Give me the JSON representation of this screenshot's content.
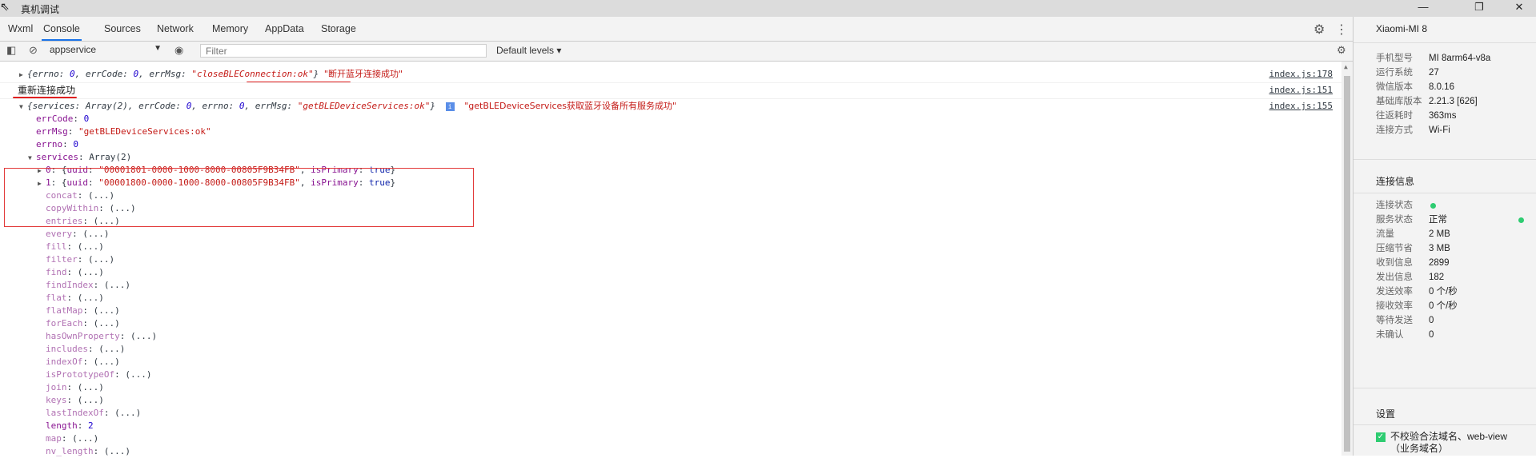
{
  "window": {
    "title": "真机调试",
    "buttons": {
      "minimize": "—",
      "restore": "❐",
      "close": "✕"
    }
  },
  "tabs": [
    {
      "label": "Wxml"
    },
    {
      "label": "Console"
    },
    {
      "label": "Sources"
    },
    {
      "label": "Network"
    },
    {
      "label": "Memory"
    },
    {
      "label": "AppData"
    },
    {
      "label": "Storage"
    }
  ],
  "toolbar": {
    "context": "appservice",
    "filter_placeholder": "Filter",
    "levels": "Default levels"
  },
  "console": {
    "line1": {
      "prefix": "{errno: ",
      "errno": "0",
      "mid1": ", errCode: ",
      "errCode": "0",
      "mid2": ", errMsg: ",
      "errMsg": "\"closeBLEConnection:ok\"",
      "suffix": "}",
      "message": "\"断开蓝牙连接成功\"",
      "source": "index.js:178"
    },
    "line2": {
      "message": "重新连接成功",
      "source": "index.js:151"
    },
    "line3": {
      "p1": "{services: Array(2), errCode: ",
      "errCode": "0",
      "p2": ", errno: ",
      "errno": "0",
      "p3": ", errMsg: ",
      "errMsg": "\"getBLEDeviceServices:ok\"",
      "p4": "}",
      "info": "i",
      "message": "\"getBLEDeviceServices获取蓝牙设备所有服务成功\"",
      "source": "index.js:155"
    },
    "props": {
      "errCode_key": "errCode",
      "errCode_val": "0",
      "errMsg_key": "errMsg",
      "errMsg_val": "\"getBLEDeviceServices:ok\"",
      "errno_key": "errno",
      "errno_val": "0",
      "services_key": "services",
      "services_val": "Array(2)"
    },
    "services": [
      {
        "idx": "0",
        "uuid": "\"00001801-0000-1000-8000-00805F9B34FB\"",
        "isPrimary": "true"
      },
      {
        "idx": "1",
        "uuid": "\"00001800-0000-1000-8000-00805F9B34FB\"",
        "isPrimary": "true"
      }
    ],
    "array_methods": [
      {
        "name": "concat",
        "val": "(...)"
      },
      {
        "name": "copyWithin",
        "val": "(...)"
      },
      {
        "name": "entries",
        "val": "(...)"
      },
      {
        "name": "every",
        "val": "(...)"
      },
      {
        "name": "fill",
        "val": "(...)"
      },
      {
        "name": "filter",
        "val": "(...)"
      },
      {
        "name": "find",
        "val": "(...)"
      },
      {
        "name": "findIndex",
        "val": "(...)"
      },
      {
        "name": "flat",
        "val": "(...)"
      },
      {
        "name": "flatMap",
        "val": "(...)"
      },
      {
        "name": "forEach",
        "val": "(...)"
      },
      {
        "name": "hasOwnProperty",
        "val": "(...)"
      },
      {
        "name": "includes",
        "val": "(...)"
      },
      {
        "name": "indexOf",
        "val": "(...)"
      },
      {
        "name": "isPrototypeOf",
        "val": "(...)"
      },
      {
        "name": "join",
        "val": "(...)"
      },
      {
        "name": "keys",
        "val": "(...)"
      },
      {
        "name": "lastIndexOf",
        "val": "(...)"
      },
      {
        "name": "length",
        "val": "2"
      },
      {
        "name": "map",
        "val": "(...)"
      },
      {
        "name": "nv_length",
        "val": "(...)"
      }
    ]
  },
  "device": {
    "name": "Xiaomi-MI 8",
    "info": [
      {
        "k": "手机型号",
        "v": "MI 8arm64-v8a"
      },
      {
        "k": "运行系统",
        "v": "27"
      },
      {
        "k": "微信版本",
        "v": "8.0.16"
      },
      {
        "k": "基础库版本",
        "v": "2.21.3 [626]"
      },
      {
        "k": "往返耗时",
        "v": "363ms"
      },
      {
        "k": "连接方式",
        "v": "Wi-Fi"
      }
    ],
    "conn_title": "连接信息",
    "conn": [
      {
        "k": "连接状态",
        "v": ""
      },
      {
        "k": "服务状态",
        "v": "正常"
      },
      {
        "k": "流量",
        "v": "2 MB"
      },
      {
        "k": "压缩节省",
        "v": "3 MB"
      },
      {
        "k": "收到信息",
        "v": "2899"
      },
      {
        "k": "发出信息",
        "v": "182"
      },
      {
        "k": "发送效率",
        "v": "0 个/秒"
      },
      {
        "k": "接收效率",
        "v": "0 个/秒"
      },
      {
        "k": "等待发送",
        "v": "0"
      },
      {
        "k": "未确认",
        "v": "0"
      }
    ],
    "settings_title": "设置",
    "setting_checkbox": "不校验合法域名、web-view（业务域名）"
  }
}
